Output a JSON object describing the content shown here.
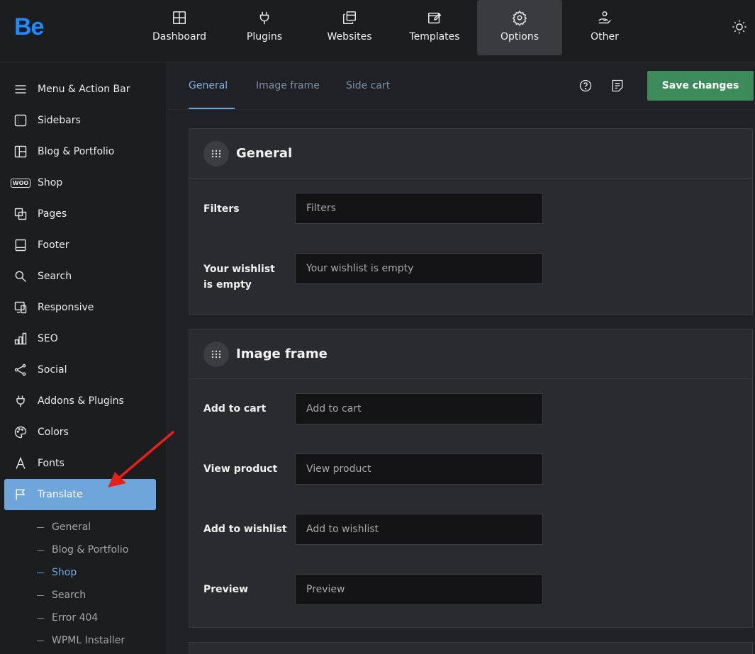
{
  "logo": "Be",
  "nav": {
    "items": [
      {
        "label": "Dashboard",
        "icon": "dashboard-icon"
      },
      {
        "label": "Plugins",
        "icon": "plug-icon"
      },
      {
        "label": "Websites",
        "icon": "websites-icon"
      },
      {
        "label": "Templates",
        "icon": "templates-icon"
      },
      {
        "label": "Options",
        "icon": "gear-icon",
        "active": true
      },
      {
        "label": "Other",
        "icon": "hand-user-icon"
      }
    ],
    "theme_icon": "sun-icon"
  },
  "sidebar": {
    "items": [
      {
        "label": "Menu & Action Bar",
        "icon": "menu-icon"
      },
      {
        "label": "Sidebars",
        "icon": "sidebar-icon"
      },
      {
        "label": "Blog & Portfolio",
        "icon": "layout-icon"
      },
      {
        "label": "Shop",
        "icon": "woo-icon",
        "icon_text": "WOO"
      },
      {
        "label": "Pages",
        "icon": "pages-icon"
      },
      {
        "label": "Footer",
        "icon": "footer-icon"
      },
      {
        "label": "Search",
        "icon": "search-icon"
      },
      {
        "label": "Responsive",
        "icon": "responsive-icon"
      },
      {
        "label": "SEO",
        "icon": "seo-icon"
      },
      {
        "label": "Social",
        "icon": "share-icon"
      },
      {
        "label": "Addons & Plugins",
        "icon": "plug-icon"
      },
      {
        "label": "Colors",
        "icon": "palette-icon"
      },
      {
        "label": "Fonts",
        "icon": "font-icon"
      },
      {
        "label": "Translate",
        "icon": "flag-icon",
        "active": true
      }
    ],
    "sub_items": [
      {
        "label": "General"
      },
      {
        "label": "Blog & Portfolio"
      },
      {
        "label": "Shop",
        "active": true
      },
      {
        "label": "Search"
      },
      {
        "label": "Error 404"
      },
      {
        "label": "WPML Installer"
      }
    ]
  },
  "header": {
    "tabs": [
      {
        "label": "General",
        "active": true
      },
      {
        "label": "Image frame"
      },
      {
        "label": "Side cart"
      }
    ],
    "help_icon": "help-icon",
    "notes_icon": "notes-icon",
    "save_label": "Save changes",
    "save_color": "#3d8b5a"
  },
  "panels": [
    {
      "title": "General",
      "fields": [
        {
          "label": "Filters",
          "value": "",
          "placeholder": "Filters"
        },
        {
          "label": "Your wishlist is empty",
          "value": "",
          "placeholder": "Your wishlist is empty"
        }
      ]
    },
    {
      "title": "Image frame",
      "fields": [
        {
          "label": "Add to cart",
          "value": "",
          "placeholder": "Add to cart"
        },
        {
          "label": "View product",
          "value": "",
          "placeholder": "View product"
        },
        {
          "label": "Add to wishlist",
          "value": "",
          "placeholder": "Add to wishlist"
        },
        {
          "label": "Preview",
          "value": "",
          "placeholder": "Preview"
        }
      ]
    }
  ],
  "colors": {
    "accent": "#6ea6dc",
    "brand": "#1f8bff",
    "annotation_arrow": "#e8201b"
  }
}
